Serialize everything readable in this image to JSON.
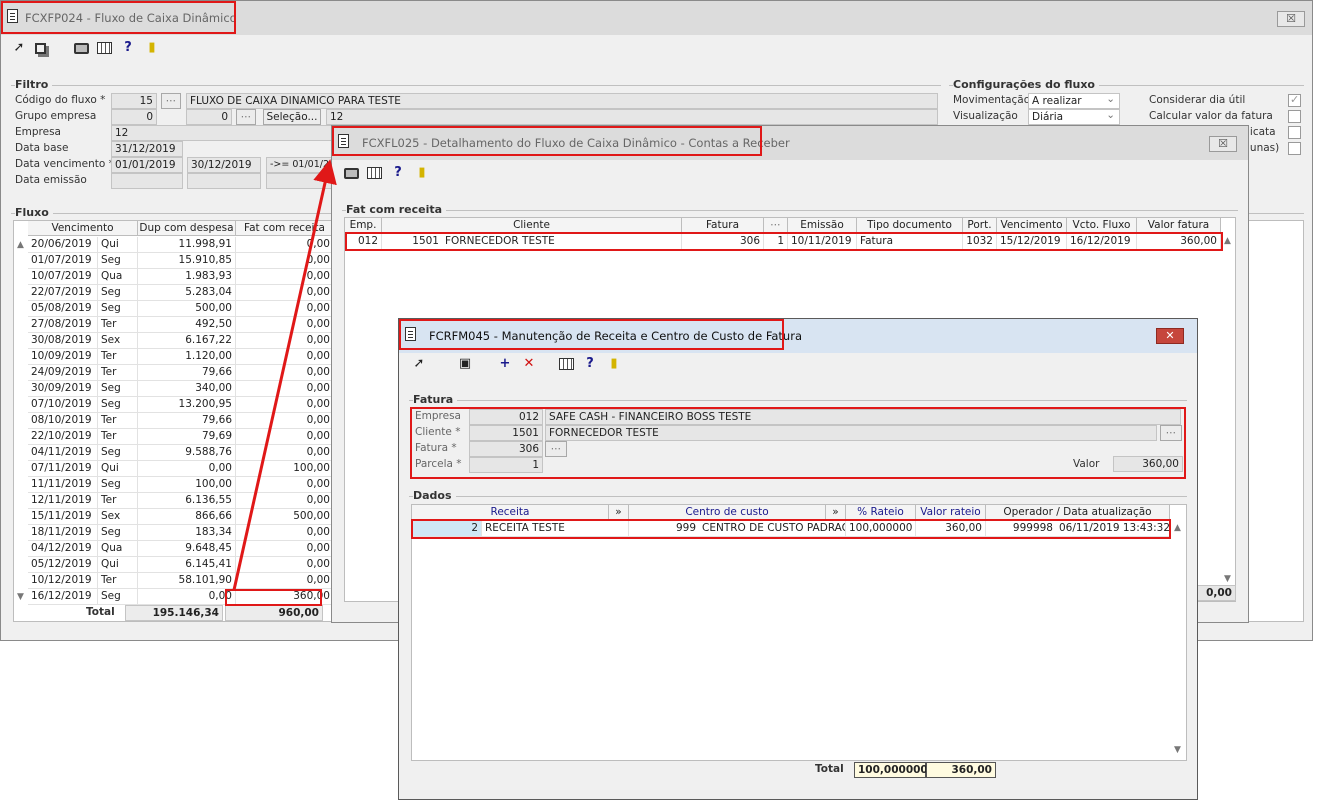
{
  "main_window": {
    "title": "FCXFP024 - Fluxo de Caixa Dinâmico",
    "close_symbol": "☒",
    "filtro": {
      "title": "Filtro",
      "codigo_label": "Código do fluxo *",
      "codigo_value": "15",
      "fluxo_nome": "FLUXO DE CAIXA DINAMICO PARA TESTE",
      "grupo_label": "Grupo empresa",
      "grupo_value": "0",
      "grupo_value2": "0",
      "selecao_label": "Seleção...",
      "selecao_value": "12",
      "empresa_label": "Empresa",
      "empresa_value": "12",
      "database_label": "Data base",
      "database_value": "31/12/2019",
      "vencimento_label": "Data vencimento *",
      "vencimento_de": "01/01/2019",
      "vencimento_ate": "30/12/2019",
      "vencimento_extra": "->= 01/01/2",
      "emissao_label": "Data emissão"
    },
    "config": {
      "title": "Configurações do fluxo",
      "movimentacao_label": "Movimentação",
      "movimentacao_value": "A realizar",
      "visualizacao_label": "Visualização",
      "visualizacao_value": "Diária",
      "dia_util_label": "Considerar dia útil",
      "valor_fatura_label": "Calcular valor da fatura",
      "partial_1": "licata",
      "partial_2": "lunas)"
    },
    "fluxo": {
      "title": "Fluxo",
      "columns": [
        "Vencimento",
        "Dup com despesa",
        "Fat com receita"
      ],
      "rows": [
        {
          "date": "20/06/2019",
          "day": "Qui",
          "dup": "11.998,91",
          "fat": "0,00"
        },
        {
          "date": "01/07/2019",
          "day": "Seg",
          "dup": "15.910,85",
          "fat": "0,00"
        },
        {
          "date": "10/07/2019",
          "day": "Qua",
          "dup": "1.983,93",
          "fat": "0,00"
        },
        {
          "date": "22/07/2019",
          "day": "Seg",
          "dup": "5.283,04",
          "fat": "0,00"
        },
        {
          "date": "05/08/2019",
          "day": "Seg",
          "dup": "500,00",
          "fat": "0,00"
        },
        {
          "date": "27/08/2019",
          "day": "Ter",
          "dup": "492,50",
          "fat": "0,00"
        },
        {
          "date": "30/08/2019",
          "day": "Sex",
          "dup": "6.167,22",
          "fat": "0,00"
        },
        {
          "date": "10/09/2019",
          "day": "Ter",
          "dup": "1.120,00",
          "fat": "0,00"
        },
        {
          "date": "24/09/2019",
          "day": "Ter",
          "dup": "79,66",
          "fat": "0,00"
        },
        {
          "date": "30/09/2019",
          "day": "Seg",
          "dup": "340,00",
          "fat": "0,00"
        },
        {
          "date": "07/10/2019",
          "day": "Seg",
          "dup": "13.200,95",
          "fat": "0,00"
        },
        {
          "date": "08/10/2019",
          "day": "Ter",
          "dup": "79,66",
          "fat": "0,00"
        },
        {
          "date": "22/10/2019",
          "day": "Ter",
          "dup": "79,69",
          "fat": "0,00"
        },
        {
          "date": "04/11/2019",
          "day": "Seg",
          "dup": "9.588,76",
          "fat": "0,00"
        },
        {
          "date": "07/11/2019",
          "day": "Qui",
          "dup": "0,00",
          "fat": "100,00"
        },
        {
          "date": "11/11/2019",
          "day": "Seg",
          "dup": "100,00",
          "fat": "0,00"
        },
        {
          "date": "12/11/2019",
          "day": "Ter",
          "dup": "6.136,55",
          "fat": "0,00"
        },
        {
          "date": "15/11/2019",
          "day": "Sex",
          "dup": "866,66",
          "fat": "500,00"
        },
        {
          "date": "18/11/2019",
          "day": "Seg",
          "dup": "183,34",
          "fat": "0,00"
        },
        {
          "date": "04/12/2019",
          "day": "Qua",
          "dup": "9.648,45",
          "fat": "0,00"
        },
        {
          "date": "05/12/2019",
          "day": "Qui",
          "dup": "6.145,41",
          "fat": "0,00"
        },
        {
          "date": "10/12/2019",
          "day": "Ter",
          "dup": "58.101,90",
          "fat": "0,00"
        },
        {
          "date": "16/12/2019",
          "day": "Seg",
          "dup": "0,00",
          "fat": "360,00"
        }
      ],
      "total_label": "Total",
      "total_dup": "195.146,34",
      "total_fat": "960,00"
    }
  },
  "detail_window": {
    "title": "FCXFL025 - Detalhamento do Fluxo de Caixa Dinâmico - Contas a Receber",
    "close_symbol": "☒",
    "group_title": "Fat com receita",
    "columns": [
      "Emp.",
      "Cliente",
      "Fatura",
      "",
      "Emissão",
      "Tipo documento",
      "Port.",
      "Vencimento",
      "Vcto. Fluxo",
      "Valor fatura"
    ],
    "row": {
      "emp": "012",
      "cli_code": "1501",
      "cli_name": "FORNECEDOR TESTE",
      "fatura": "306",
      "parcela": "1",
      "emissao": "10/11/2019",
      "tipo": "Fatura",
      "port": "1032",
      "vencimento": "15/12/2019",
      "vcto_fluxo": "16/12/2019",
      "valor": "360,00"
    },
    "footer_value": "0,00"
  },
  "maint_window": {
    "title": "FCRFM045 - Manutenção de Receita e Centro de Custo de Fatura",
    "close_symbol": "✕",
    "fatura": {
      "title": "Fatura",
      "empresa_label": "Empresa",
      "empresa_code": "012",
      "empresa_name": "SAFE CASH - FINANCEIRO BOSS TESTE",
      "cliente_label": "Cliente *",
      "cliente_code": "1501",
      "cliente_name": "FORNECEDOR TESTE",
      "fatura_label": "Fatura *",
      "fatura_value": "306",
      "parcela_label": "Parcela *",
      "parcela_value": "1",
      "valor_label": "Valor",
      "valor_value": "360,00"
    },
    "dados": {
      "title": "Dados",
      "columns": [
        "Receita",
        "»",
        "Centro de custo",
        "»",
        "% Rateio",
        "Valor rateio",
        "Operador / Data atualização"
      ],
      "row": {
        "receita_code": "2",
        "receita_name": "RECEITA TESTE",
        "cc_code": "999",
        "cc_name": "CENTRO DE CUSTO PADRAO",
        "rateio": "100,000000",
        "valor_rateio": "360,00",
        "operador": "999998",
        "data": "06/11/2019 13:43:32"
      },
      "total_label": "Total",
      "total_rateio": "100,000000",
      "total_valor": "360,00"
    }
  },
  "colors": {
    "highlight": "#e01818",
    "header_blue": "#1a1a8c",
    "selection": "#cfe7f5"
  }
}
